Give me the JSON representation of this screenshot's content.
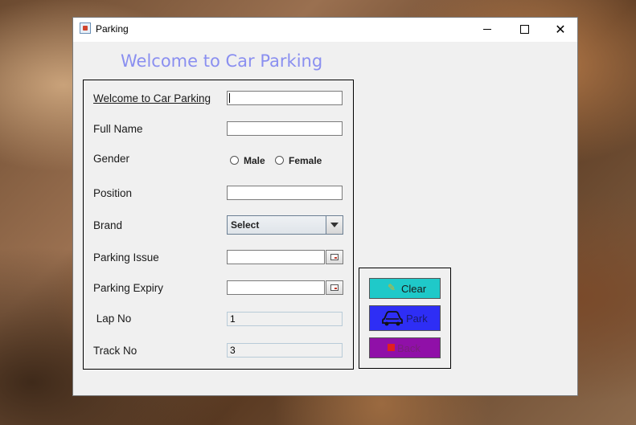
{
  "window": {
    "title": "Parking",
    "controls": {
      "minimize": "minimize-icon",
      "maximize": "maximize-icon",
      "close": "close-icon"
    }
  },
  "heading": "Welcome to Car Parking",
  "form": {
    "labels": {
      "welcome": "Welcome to Car Parking",
      "full_name": "Full Name",
      "gender": "Gender",
      "position": "Position",
      "brand": "Brand",
      "parking_issue": "Parking Issue",
      "parking_expiry": "Parking Expiry",
      "lap_no": " Lap No",
      "track_no": "Track No"
    },
    "values": {
      "welcome": "",
      "full_name": "",
      "position": "",
      "parking_issue": "",
      "parking_expiry": "",
      "lap_no": "1",
      "track_no": "3"
    },
    "gender_options": [
      "Male",
      "Female"
    ],
    "brand_selected": "Select"
  },
  "buttons": {
    "clear": "Clear",
    "park": "Park",
    "back": "Back"
  },
  "colors": {
    "heading": "#8a8ff0",
    "clear_bg": "#1fc9c9",
    "park_bg": "#2e2ef5",
    "back_bg": "#9010a8"
  }
}
